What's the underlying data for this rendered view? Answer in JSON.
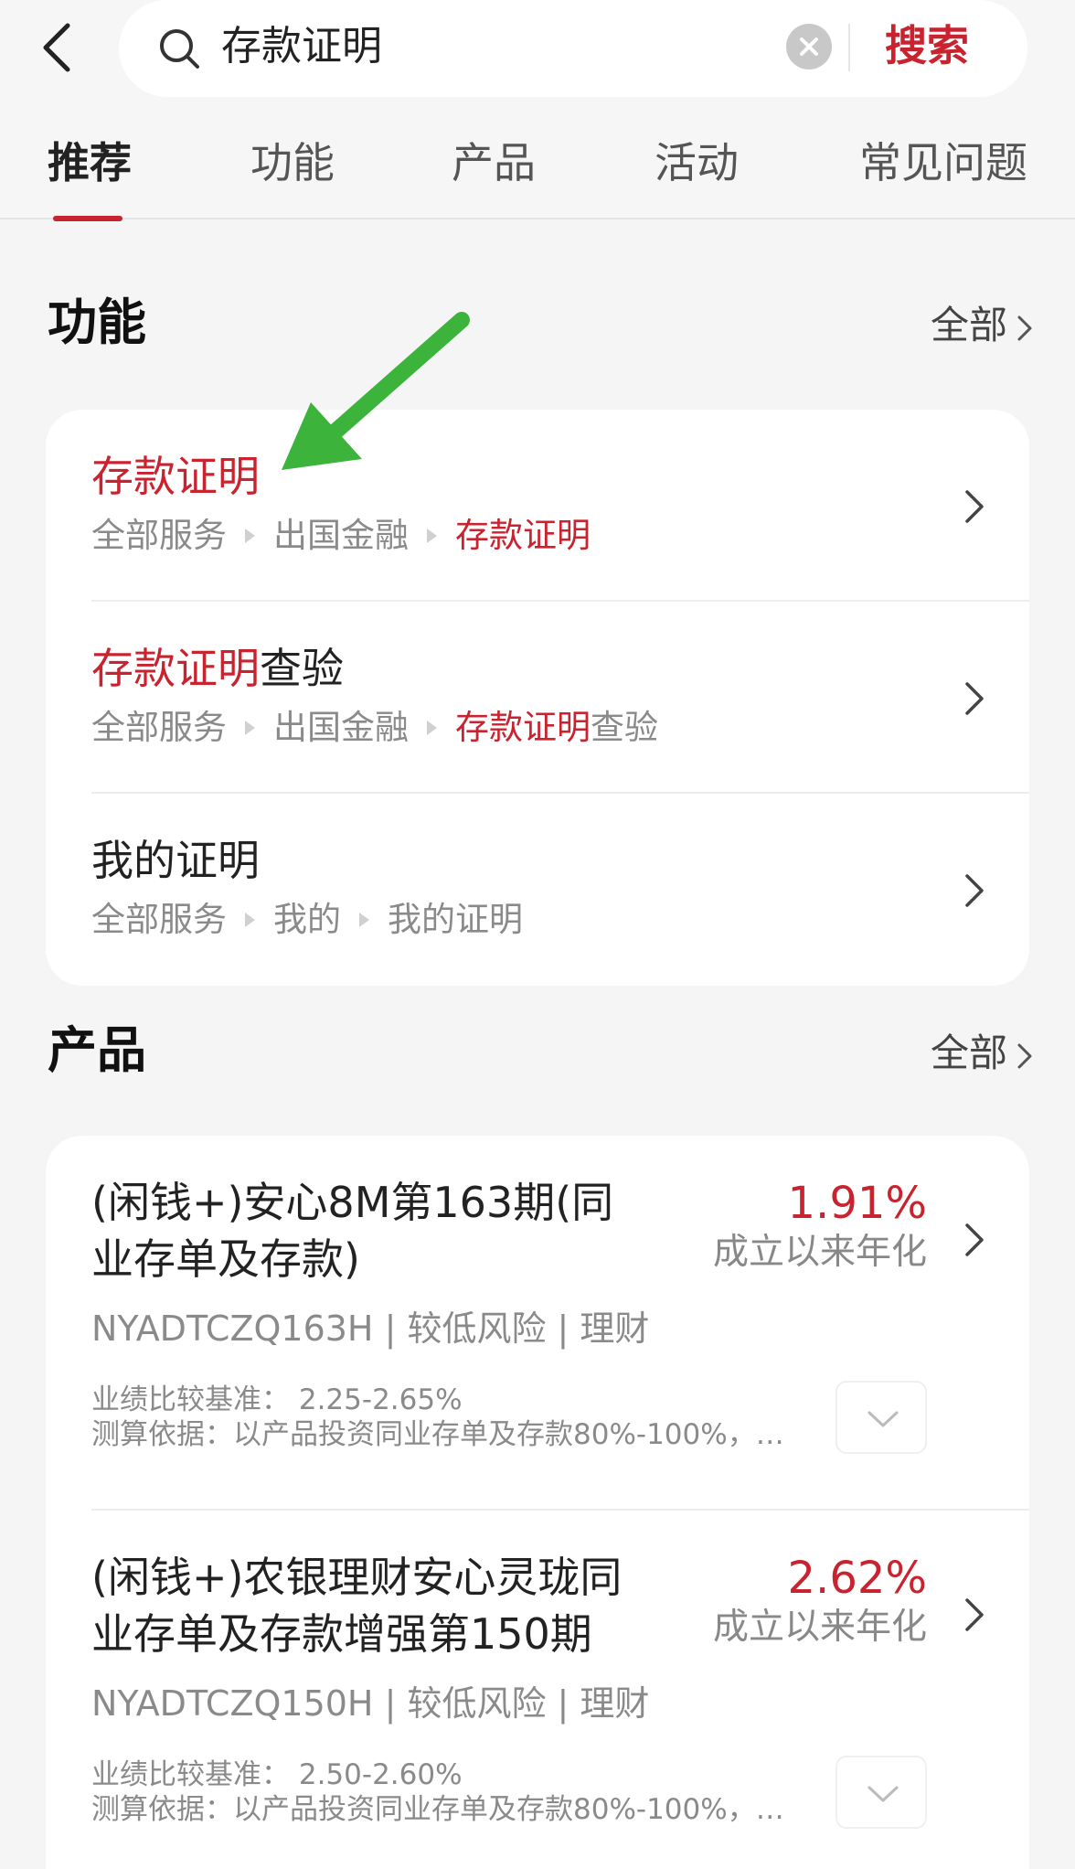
{
  "search": {
    "query": "存款证明",
    "button_label": "搜索"
  },
  "tabs": [
    {
      "label": "推荐",
      "active": true
    },
    {
      "label": "功能",
      "active": false
    },
    {
      "label": "产品",
      "active": false
    },
    {
      "label": "活动",
      "active": false
    },
    {
      "label": "常见问题",
      "active": false
    }
  ],
  "functions": {
    "title": "功能",
    "see_all": "全部",
    "items": [
      {
        "title_highlight": "存款证明",
        "title_rest": "",
        "path": [
          "全部服务",
          "出国金融"
        ],
        "path_last_highlight": "存款证明",
        "path_last_rest": ""
      },
      {
        "title_highlight": "存款证明",
        "title_rest": "查验",
        "path": [
          "全部服务",
          "出国金融"
        ],
        "path_last_highlight": "存款证明",
        "path_last_rest": "查验"
      },
      {
        "title_highlight": "",
        "title_rest": "我的证明",
        "path": [
          "全部服务",
          "我的"
        ],
        "path_last_highlight": "",
        "path_last_rest": "我的证明"
      }
    ]
  },
  "products": {
    "title": "产品",
    "see_all": "全部",
    "items": [
      {
        "name": "(闲钱+)安心8M第163期(同业存单及存款)",
        "rate": "1.91%",
        "rate_label": "成立以来年化",
        "meta": "NYADTCZQ163H | 较低风险 | 理财",
        "benchmark": "业绩比较基准： 2.25-2.65%",
        "basis": "测算依据：以产品投资同业存单及存款80%-100%，…"
      },
      {
        "name": "(闲钱+)农银理财安心灵珑同业存单及存款增强第150期",
        "rate": "2.62%",
        "rate_label": "成立以来年化",
        "meta": "NYADTCZQ150H | 较低风险 | 理财",
        "benchmark": "业绩比较基准： 2.50-2.60%",
        "basis": "测算依据：以产品投资同业存单及存款80%-100%，…"
      }
    ]
  },
  "colors": {
    "accent": "#c8232f",
    "annotation_arrow": "#3cb43c"
  },
  "icons": {
    "back": "back-arrow-icon",
    "search": "search-icon",
    "clear": "clear-icon",
    "chevron": "chevron-right-icon",
    "expand": "chevron-down-icon"
  }
}
